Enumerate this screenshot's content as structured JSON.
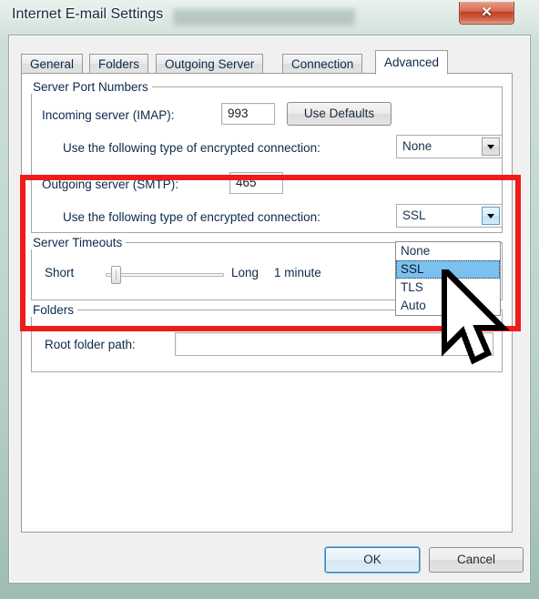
{
  "window": {
    "title": "Internet E-mail Settings",
    "close_label": "✕"
  },
  "tabs": [
    {
      "label": "General",
      "active": false
    },
    {
      "label": "Folders",
      "active": false
    },
    {
      "label": "Outgoing Server",
      "active": false
    },
    {
      "label": "Connection",
      "active": false
    },
    {
      "label": "Advanced",
      "active": true
    }
  ],
  "groups": {
    "server_port_numbers": "Server Port Numbers",
    "server_timeouts": "Server Timeouts",
    "folders": "Folders"
  },
  "fields": {
    "incoming_label": "Incoming server (IMAP):",
    "incoming_value": "993",
    "use_defaults_label": "Use Defaults",
    "incoming_encrypt_label": "Use the following type of encrypted connection:",
    "incoming_encrypt_value": "None",
    "outgoing_label": "Outgoing server (SMTP):",
    "outgoing_value": "465",
    "outgoing_encrypt_label": "Use the following type of encrypted connection:",
    "outgoing_encrypt_value": "SSL",
    "timeout_short_label": "Short",
    "timeout_long_label": "Long",
    "timeout_value": "1 minute",
    "root_folder_label": "Root folder path:",
    "root_folder_value": ""
  },
  "dropdown": {
    "open": true,
    "options": [
      "None",
      "SSL",
      "TLS",
      "Auto"
    ],
    "selected": "SSL"
  },
  "buttons": {
    "ok": "OK",
    "cancel": "Cancel"
  },
  "colors": {
    "highlight_rect": "#ef1b1b",
    "selection": "#7cc0ef",
    "accent_focus": "#3c7fb1",
    "label_text": "#0b2a4a"
  }
}
